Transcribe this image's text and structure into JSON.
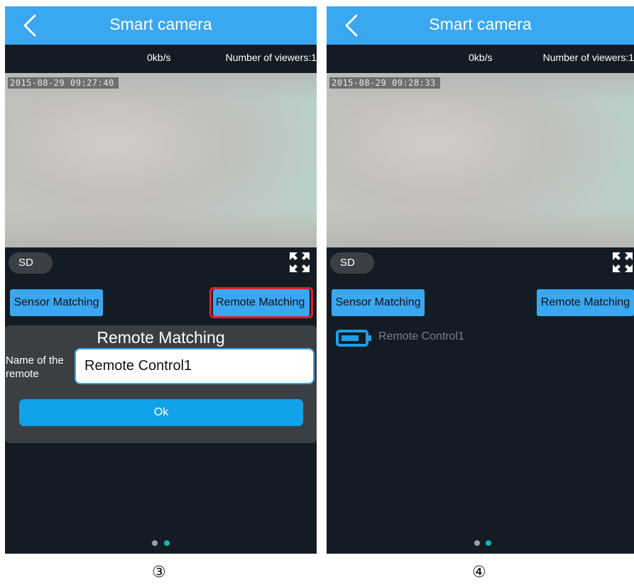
{
  "panel3": {
    "title": "Smart camera",
    "rate": "0kb/s",
    "viewers": "Number of viewers:1",
    "timestamp": "2015-08-29  09:27:40",
    "quality": "SD",
    "sensor_btn": "Sensor Matching",
    "remote_btn": "Remote Matching",
    "dialog": {
      "title": "Remote Matching",
      "name_label": "Name of the remote",
      "name_value": "Remote Control1",
      "ok": "Ok"
    },
    "caption": "③"
  },
  "panel4": {
    "title": "Smart camera",
    "rate": "0kb/s",
    "viewers": "Number of viewers:1",
    "timestamp": "2015-08-29  09:28:33",
    "quality": "SD",
    "sensor_btn": "Sensor Matching",
    "remote_btn": "Remote Matching",
    "remote_item": "Remote Control1",
    "caption": "④"
  },
  "colors": {
    "accent": "#3aa7f1",
    "ok_button": "#11a2ea",
    "background": "#131c24",
    "highlight": "#e81c2b",
    "dot_inactive": "#9aa0a5",
    "dot_active": "#12b5b0",
    "battery": "#1e9fe6"
  },
  "icons": [
    "back-arrow-icon",
    "fullscreen-icon",
    "battery-icon"
  ]
}
